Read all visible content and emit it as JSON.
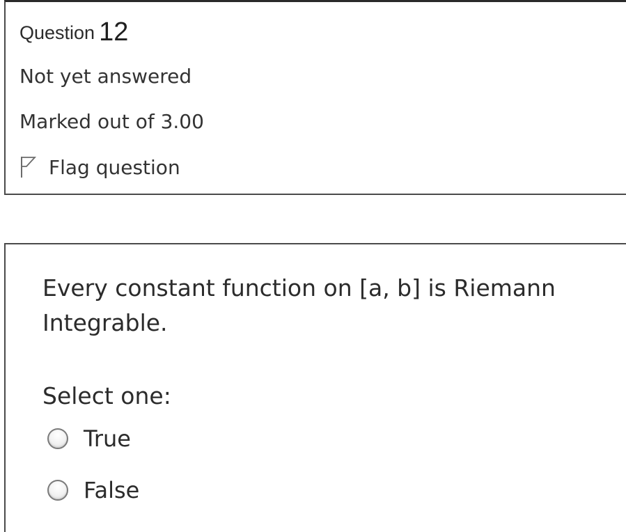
{
  "question_info": {
    "label": "Question",
    "number": "12",
    "state": "Not yet answered",
    "grade": "Marked out of 3.00",
    "flag_label": "Flag question",
    "flag_icon": "flag-outline-icon"
  },
  "question": {
    "text": "Every constant function on [a, b] is Riemann Integrable.",
    "prompt": "Select one:",
    "options": [
      {
        "label": "True",
        "selected": false
      },
      {
        "label": "False",
        "selected": false
      }
    ]
  }
}
